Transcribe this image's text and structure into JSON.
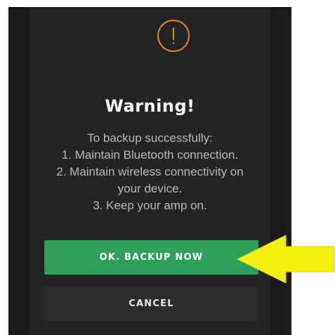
{
  "dialog": {
    "icon": "warning-exclamation-icon",
    "title": "Warning!",
    "message_lines": [
      "To backup successfully:",
      "1. Maintain Bluetooth connection.",
      "2. Maintain wireless connectivity on",
      "your device.",
      "3. Keep your amp on."
    ],
    "primary_button": "OK. BACKUP NOW",
    "secondary_button": "CANCEL"
  },
  "annotation": {
    "icon": "yellow-arrow-icon"
  },
  "colors": {
    "background": "#242426",
    "warning_accent": "#e08a12",
    "primary_button": "#2e9e5b",
    "secondary_button": "#2c2c2e",
    "arrow": "#f7ee12"
  }
}
